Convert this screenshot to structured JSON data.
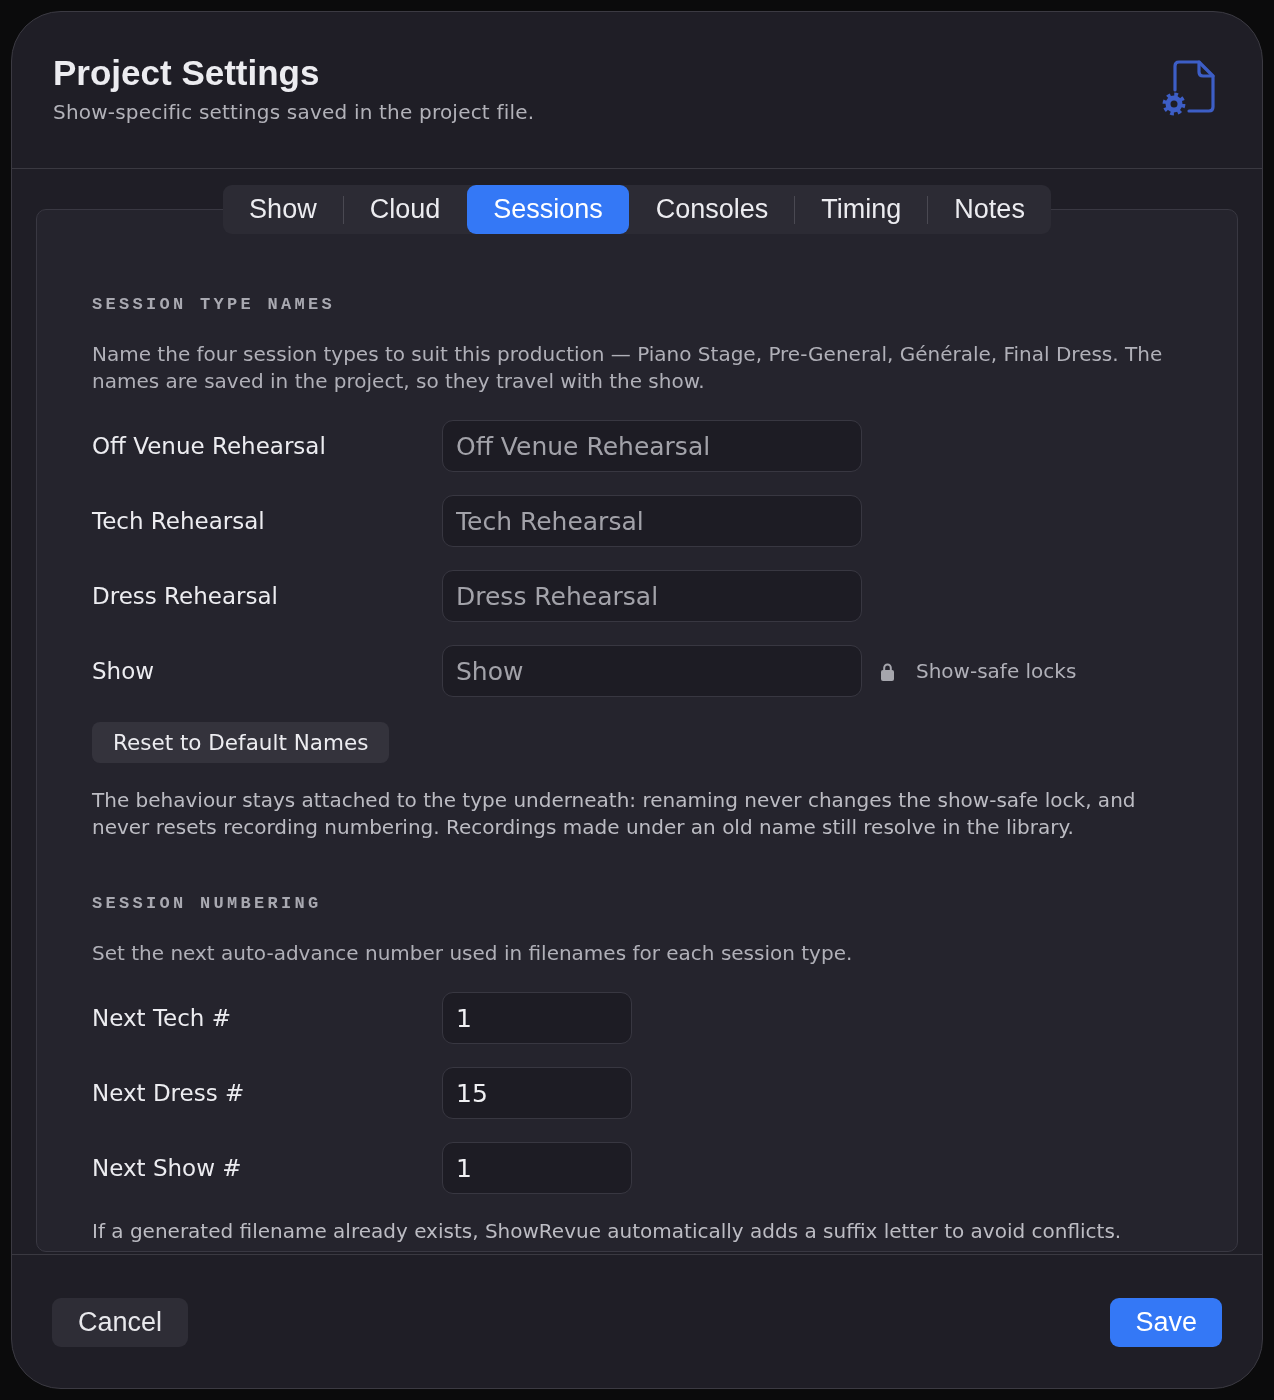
{
  "window": {
    "title": "Project Settings",
    "subtitle": "Show-specific settings saved in the project file."
  },
  "tabs": [
    {
      "label": "Show",
      "selected": false
    },
    {
      "label": "Cloud",
      "selected": false
    },
    {
      "label": "Sessions",
      "selected": true
    },
    {
      "label": "Consoles",
      "selected": false
    },
    {
      "label": "Timing",
      "selected": false
    },
    {
      "label": "Notes",
      "selected": false
    }
  ],
  "sections": [
    {
      "kind": "names",
      "heading": "SESSION TYPE NAMES",
      "description": "Name the four session types to suit this production — Piano Stage, Pre-General, Générale, Final Dress. The names are saved in the project, so they travel with the show.",
      "rows": [
        {
          "label": "Off Venue Rehearsal",
          "placeholder": "Off Venue Rehearsal",
          "locked": false
        },
        {
          "label": "Tech Rehearsal",
          "placeholder": "Tech Rehearsal",
          "locked": false
        },
        {
          "label": "Dress Rehearsal",
          "placeholder": "Dress Rehearsal",
          "locked": false
        },
        {
          "label": "Show",
          "placeholder": "Show",
          "locked": true,
          "note": "Show-safe locks"
        }
      ],
      "button": "Reset to Default Names",
      "note": "The behaviour stays attached to the type underneath: renaming never changes the show-safe lock, and never resets recording numbering. Recordings made under an old name still resolve in the library."
    },
    {
      "kind": "numbering",
      "heading": "SESSION NUMBERING",
      "description": "Set the next auto-advance number used in filenames for each session type.",
      "rows": [
        {
          "label": "Next Tech #",
          "value": "1"
        },
        {
          "label": "Next Dress #",
          "value": "15"
        },
        {
          "label": "Next Show #",
          "value": "1"
        }
      ],
      "note": "If a generated filename already exists, ShowRevue automatically adds a suffix letter to avoid conflicts."
    }
  ],
  "buttons": [
    {
      "label": "Cancel",
      "kind": "secondary"
    },
    {
      "label": "Save",
      "kind": "primary"
    }
  ]
}
